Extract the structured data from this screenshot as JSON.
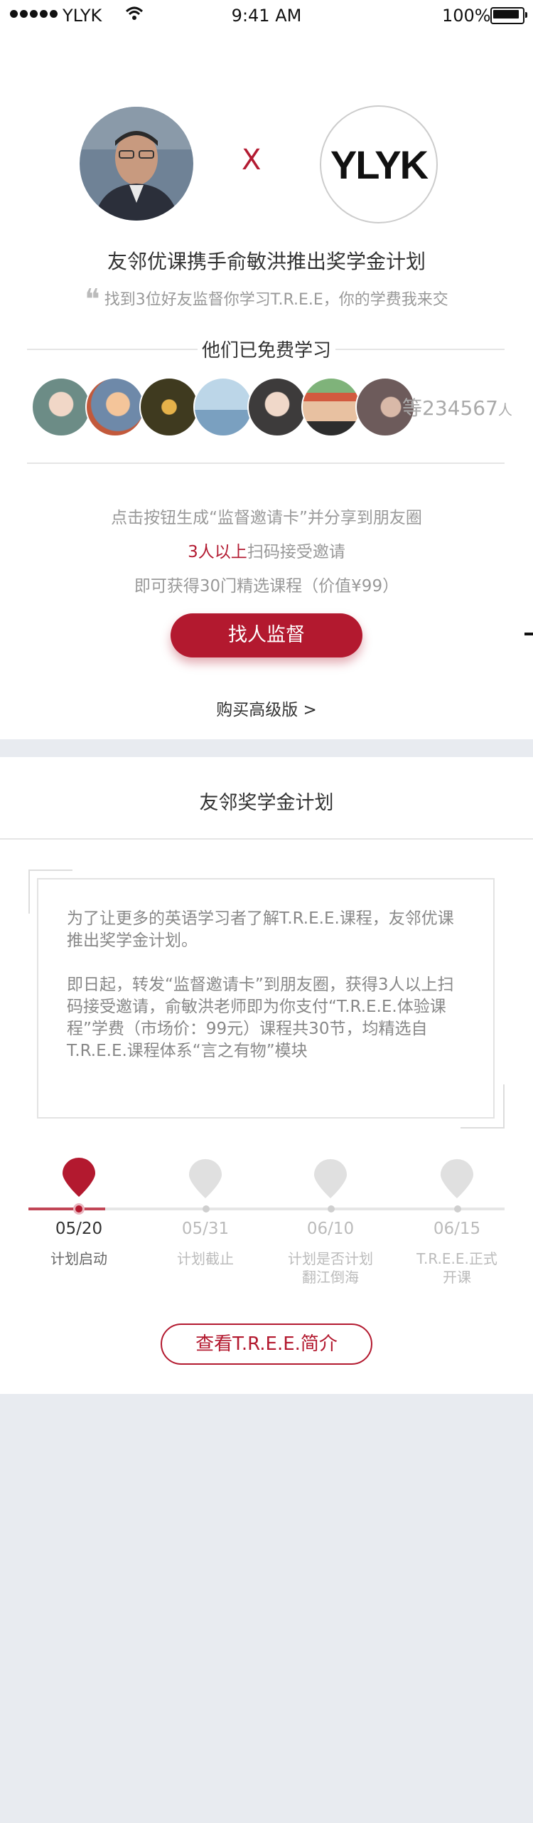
{
  "status_bar": {
    "carrier": "YLYK",
    "time": "9:41 AM",
    "battery": "100%"
  },
  "hero": {
    "connector": "X",
    "brand_logo": "YLYK",
    "title": "友邻优课携手俞敏洪推出奖学金计划",
    "subtitle": "找到3位好友监督你学习T.R.E.E，你的学费我来交"
  },
  "learners": {
    "heading": "他们已免费学习",
    "count_prefix": "等234567",
    "count_unit": "人"
  },
  "invite": {
    "line1": "点击按钮生成“监督邀请卡”并分享到朋友圈",
    "line2_highlight": "3人以上",
    "line2_rest": "扫码接受邀请",
    "line3": "即可获得30门精选课程（价值¥99）",
    "button": "找人监督",
    "buy_link": "购买高级版 >"
  },
  "plan": {
    "title": "友邻奖学金计划",
    "paragraph1": "为了让更多的英语学习者了解T.R.E.E.课程，友邻优课推出奖学金计划。",
    "paragraph2": "即日起，转发“监督邀请卡”到朋友圈，获得3人以上扫码接受邀请，俞敏洪老师即为你支付“T.R.E.E.体验课程”学费（市场价：99元）课程共30节，均精选自T.R.E.E.课程体系“言之有物”模块"
  },
  "timeline": [
    {
      "date": "05/20",
      "label": "计划启动",
      "active": true
    },
    {
      "date": "05/31",
      "label": "计划截止",
      "active": false
    },
    {
      "date": "06/10",
      "label": "计划是否计划翻江倒海",
      "active": false
    },
    {
      "date": "06/15",
      "label": "T.R.E.E.正式开课",
      "active": false
    }
  ],
  "intro_button": "查看T.R.E.E.简介",
  "colors": {
    "accent": "#b3192f",
    "inactive": "#e0e0e0",
    "background": "#e8ebf0"
  },
  "icons": [
    "signal-dots-icon",
    "wifi-icon",
    "battery-icon",
    "quote-icon",
    "location-pin-icon"
  ]
}
